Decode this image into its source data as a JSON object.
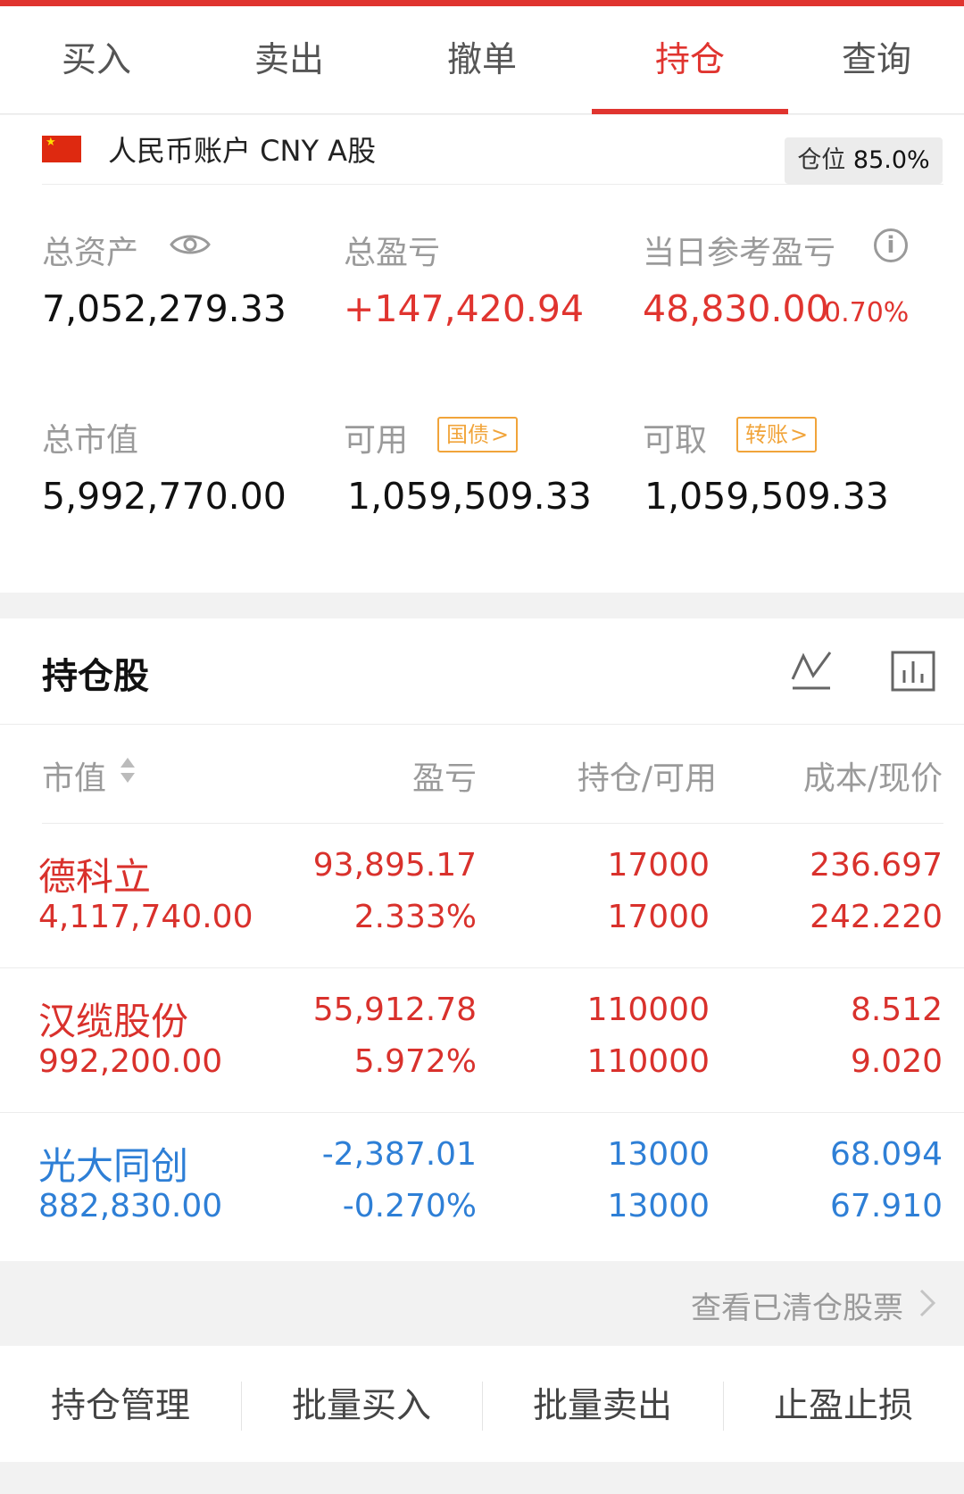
{
  "tabs": [
    {
      "label": "买入",
      "active": false
    },
    {
      "label": "卖出",
      "active": false
    },
    {
      "label": "撤单",
      "active": false
    },
    {
      "label": "持仓",
      "active": true
    },
    {
      "label": "查询",
      "active": false
    }
  ],
  "colors": {
    "accent_red": "#e0342f",
    "loss_blue": "#2e7fd6",
    "tag_orange": "#f1a43a"
  },
  "account": {
    "flag_icon": "china-flag-icon",
    "name": "人民币账户 CNY A股",
    "position_label": "仓位",
    "position_value": "85.0%",
    "total_assets_label": "总资产",
    "total_assets_value": "7,052,279.33",
    "total_pl_label": "总盈亏",
    "total_pl_value": "+147,420.94",
    "day_pl_label": "当日参考盈亏",
    "day_pl_value": "48,830.00",
    "day_pl_pct": "0.70%",
    "market_value_label": "总市值",
    "market_value_value": "5,992,770.00",
    "available_label": "可用",
    "available_tag": "国债",
    "available_value": "1,059,509.33",
    "withdrawable_label": "可取",
    "withdrawable_tag": "转账",
    "withdrawable_value": "1,059,509.33"
  },
  "holdings": {
    "title": "持仓股",
    "columns": [
      "市值",
      "盈亏",
      "持仓/可用",
      "成本/现价"
    ],
    "rows": [
      {
        "name": "德科立",
        "market_value": "4,117,740.00",
        "pl": "93,895.17",
        "pl_pct": "2.333%",
        "holding": "17000",
        "available": "17000",
        "cost": "236.697",
        "price": "242.220",
        "trend": "up"
      },
      {
        "name": "汉缆股份",
        "market_value": "992,200.00",
        "pl": "55,912.78",
        "pl_pct": "5.972%",
        "holding": "110000",
        "available": "110000",
        "cost": "8.512",
        "price": "9.020",
        "trend": "up"
      },
      {
        "name": "光大同创",
        "market_value": "882,830.00",
        "pl": "-2,387.01",
        "pl_pct": "-0.270%",
        "holding": "13000",
        "available": "13000",
        "cost": "68.094",
        "price": "67.910",
        "trend": "down"
      }
    ]
  },
  "cleared_link": "查看已清仓股票",
  "actions": [
    "持仓管理",
    "批量买入",
    "批量卖出",
    "止盈止损"
  ]
}
